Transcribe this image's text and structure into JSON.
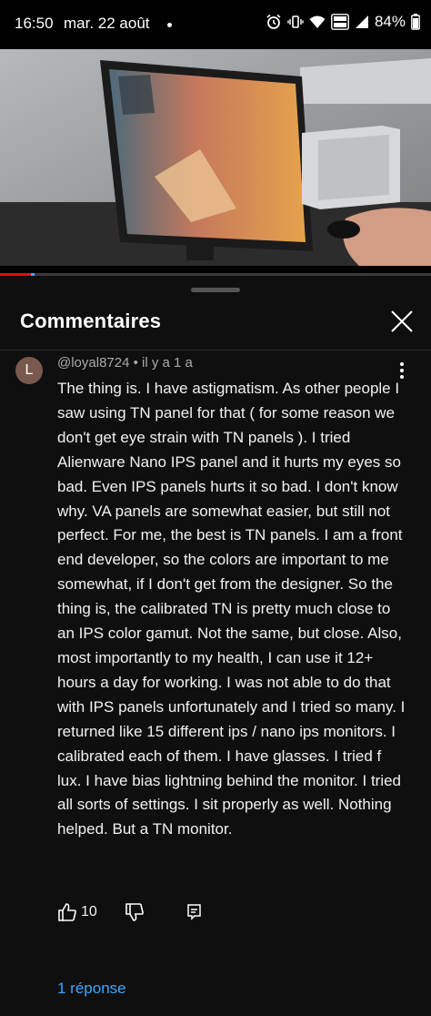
{
  "status_bar": {
    "time": "16:50",
    "date": "mar. 22 août",
    "battery": "84%",
    "icons": [
      "alarm-icon",
      "vibrate-icon",
      "wifi-icon",
      "volte-icon",
      "signal-icon",
      "battery-icon"
    ]
  },
  "video": {
    "description_icon": "video-thumbnail",
    "progress_fraction": 0.075,
    "progress_color": "#e50914"
  },
  "comments_panel": {
    "title": "Commentaires",
    "close_icon": "close-icon"
  },
  "comment": {
    "avatar_letter": "L",
    "avatar_color": "#79594d",
    "author_meta": "@loyal8724 • il y a 1 a",
    "text": "The thing is. I have astigmatism. As other people I saw using TN panel for that ( for some reason we don't get eye strain with TN panels ). I tried Alienware Nano IPS panel and it hurts my eyes so bad. Even IPS panels hurts it so bad. I don't know why. VA panels are somewhat easier, but still not perfect. For me, the best is TN panels. I am a front end developer, so the colors are important to me somewhat, if I don't get from the designer. So the thing is, the calibrated TN is pretty much close to an IPS color gamut. Not the same, but close. Also, most importantly to my health, I can use it 12+ hours a day for working. I was not able to do that with IPS panels unfortunately and I tried so many. I returned like 15 different ips / nano ips monitors. I calibrated each of them. I have glasses. I tried f lux. I have bias lightning behind the monitor. I tried all sorts of settings. I sit properly as well. Nothing helped. But a TN monitor.",
    "like_count": "10",
    "replies_label": "1 réponse"
  },
  "colors": {
    "background": "#0f0f0f",
    "link": "#3ea6ff",
    "muted_text": "#aaaaaa"
  }
}
